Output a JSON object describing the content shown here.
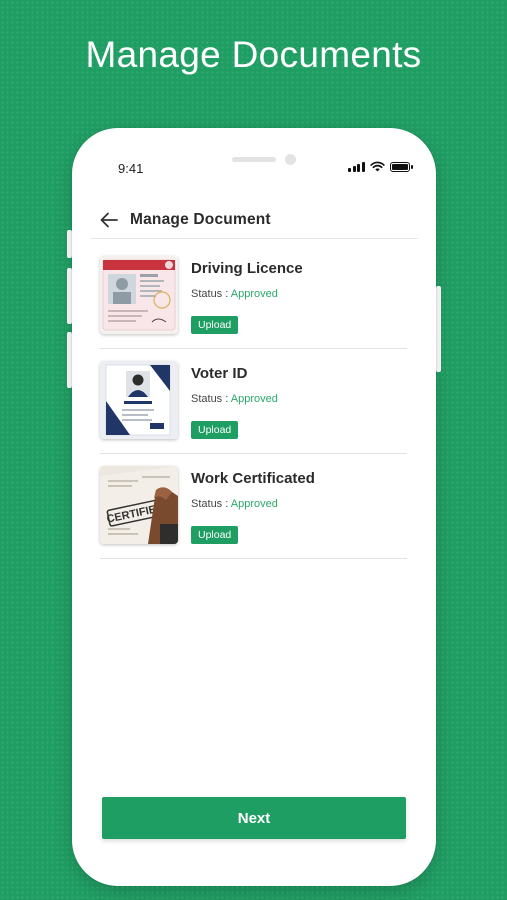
{
  "headline": "Manage Documents",
  "status_bar": {
    "time": "9:41"
  },
  "appbar": {
    "title": "Manage Document"
  },
  "documents": [
    {
      "name": "Driving Licence",
      "status_label": "Status :",
      "status_value": "Approved",
      "upload_label": "Upload",
      "icon": "driving-licence-thumbnail"
    },
    {
      "name": "Voter ID",
      "status_label": "Status :",
      "status_value": "Approved",
      "upload_label": "Upload",
      "icon": "voter-id-thumbnail"
    },
    {
      "name": "Work Certificated",
      "status_label": "Status :",
      "status_value": "Approved",
      "upload_label": "Upload",
      "icon": "certificate-thumbnail"
    }
  ],
  "thumb_texts": {
    "certified": "CERTIFIED"
  },
  "next_label": "Next",
  "colors": {
    "brand": "#1f9e63",
    "approved": "#2aa86b"
  }
}
